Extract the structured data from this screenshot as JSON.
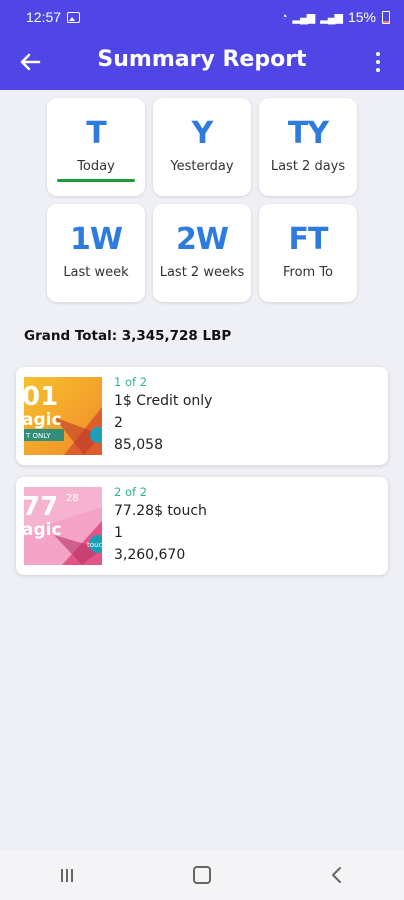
{
  "status_bar": {
    "time": "12:57",
    "battery": "15%"
  },
  "header": {
    "title": "Summary Report"
  },
  "filters": [
    {
      "abbr": "T",
      "label": "Today",
      "selected": true
    },
    {
      "abbr": "Y",
      "label": "Yesterday",
      "selected": false
    },
    {
      "abbr": "TY",
      "label": "Last 2 days",
      "selected": false
    },
    {
      "abbr": "1W",
      "label": "Last week",
      "selected": false
    },
    {
      "abbr": "2W",
      "label": "Last 2 weeks",
      "selected": false
    },
    {
      "abbr": "FT",
      "label": "From To",
      "selected": false
    }
  ],
  "grand_total": "Grand Total: 3,345,728 LBP",
  "items": [
    {
      "index": "1 of 2",
      "name": "1$ Credit only",
      "quantity": "2",
      "amount": "85,058",
      "thumb_text": "01",
      "thumb_sub": "agic",
      "thumb_tag": "T ONLY"
    },
    {
      "index": "2 of 2",
      "name": "77.28$ touch",
      "quantity": "1",
      "amount": "3,260,670",
      "thumb_text": "77",
      "thumb_small": "28",
      "thumb_sub": "agic",
      "thumb_tag": "touch"
    }
  ],
  "colors": {
    "primary": "#4f46e5",
    "accent_text": "#2e7be0",
    "selected_underline": "#1e9a3a",
    "index_text": "#2bb39a"
  }
}
